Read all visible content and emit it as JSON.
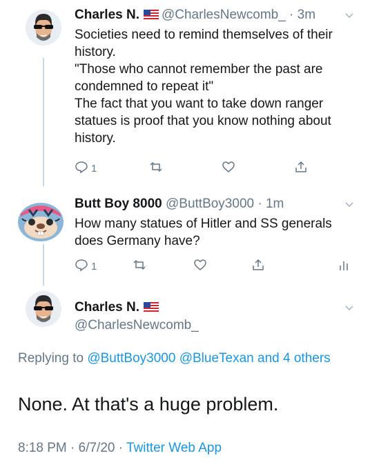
{
  "tweet1": {
    "name": "Charles N.",
    "handle": "@CharlesNewcomb_",
    "time": "3m",
    "text": "Societies need to remind themselves of their history.\n\"Those who cannot remember the past are condemned to repeat it\"\nThe fact that you want to take down ranger statues is proof that you know nothing about history.",
    "reply_count": "1",
    "icons": [
      "reply-icon",
      "retweet-icon",
      "like-icon",
      "share-icon"
    ]
  },
  "tweet2": {
    "name": "Butt Boy 8000",
    "handle": "@ButtBoy3000",
    "time": "1m",
    "text": "How many statues of Hitler and SS generals does Germany have?",
    "reply_count": "1",
    "icons": [
      "reply-icon",
      "retweet-icon",
      "like-icon",
      "share-icon",
      "analytics-icon"
    ]
  },
  "tweet3": {
    "name": "Charles N.",
    "handle": "@CharlesNewcomb_",
    "replying_prefix": "Replying to",
    "replying_1": "@ButtBoy3000",
    "replying_2": "@BlueTexan",
    "replying_more": "and 4 others",
    "text": "None. At that's a huge problem.",
    "timestamp": "8:18 PM · 6/7/20 ·",
    "client": "Twitter Web App"
  },
  "colors": {
    "link": "#1b95e0",
    "muted": "#657786",
    "thread": "#ccd6dd"
  }
}
